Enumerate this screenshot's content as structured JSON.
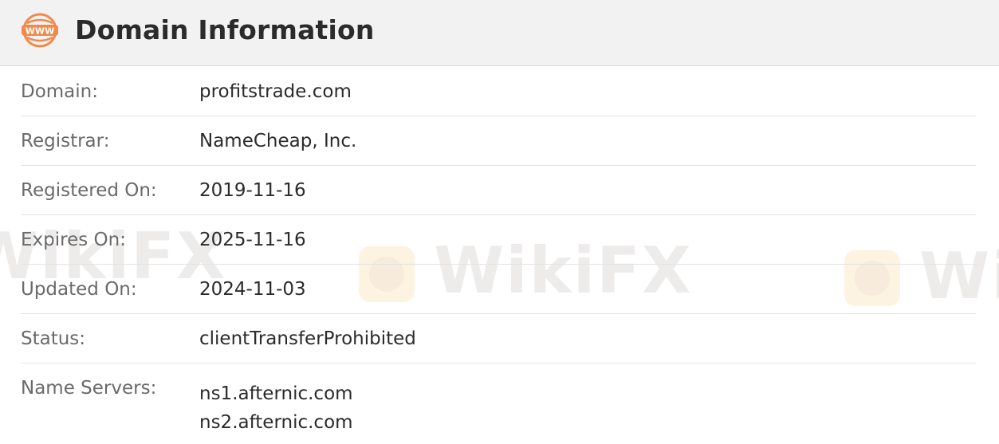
{
  "header": {
    "title": "Domain Information",
    "icon": "www-globe-icon",
    "icon_label": "WWW",
    "icon_color": "#f08a4b"
  },
  "rows": [
    {
      "label": "Domain:",
      "value": "profitstrade.com"
    },
    {
      "label": "Registrar:",
      "value": "NameCheap, Inc."
    },
    {
      "label": "Registered On:",
      "value": "2019-11-16"
    },
    {
      "label": "Expires On:",
      "value": "2025-11-16"
    },
    {
      "label": "Updated On:",
      "value": "2024-11-03"
    },
    {
      "label": "Status:",
      "value": "clientTransferProhibited"
    }
  ],
  "name_servers": {
    "label": "Name Servers:",
    "values": [
      "ns1.afternic.com",
      "ns2.afternic.com"
    ]
  },
  "watermark": {
    "text": "WikiFX",
    "partial_text": "WikiFX",
    "edge_text": "Wi",
    "color": "#f2b84b"
  }
}
